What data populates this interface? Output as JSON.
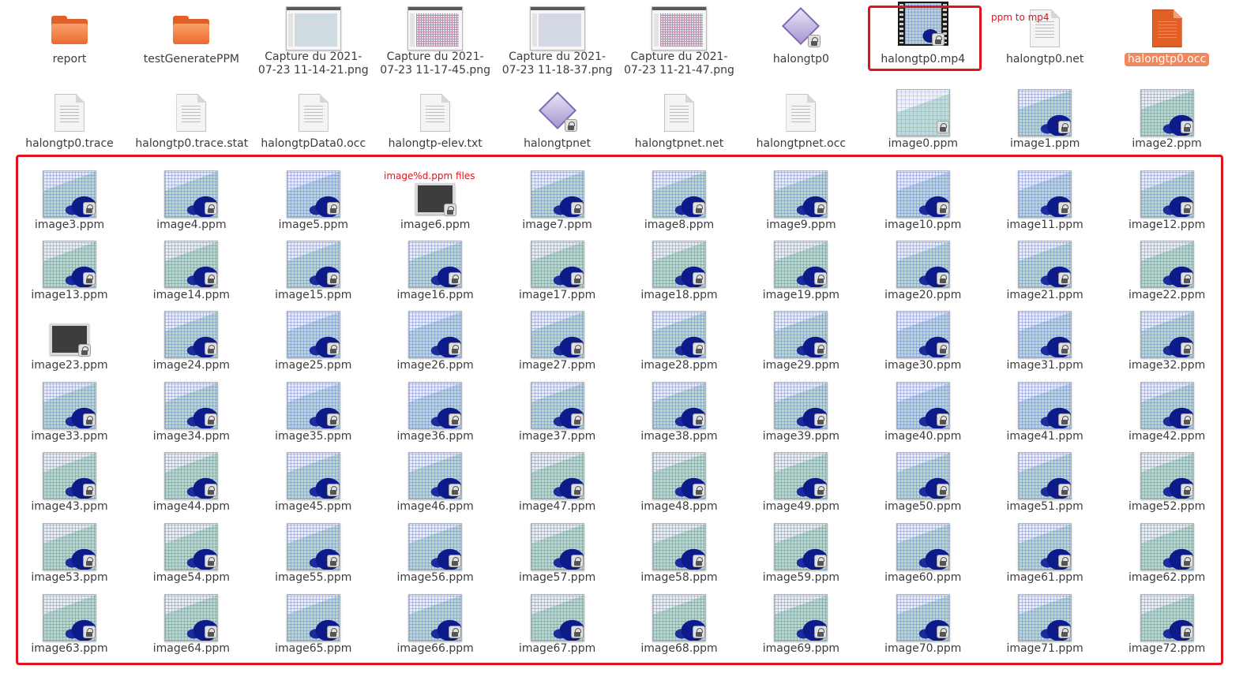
{
  "colors": {
    "annotation": "#e0141f",
    "selection": "#f0875e",
    "folder": "#e35f28"
  },
  "annotations": {
    "mp4_note": "ppm to mp4",
    "ppm_note": "image%d.ppm files"
  },
  "files": [
    {
      "name": "report",
      "kind": "folder"
    },
    {
      "name": "testGeneratePPM",
      "kind": "folder"
    },
    {
      "name": "Capture du 2021-07-23 11-14-21.png",
      "kind": "screenshot"
    },
    {
      "name": "Capture du 2021-07-23 11-17-45.png",
      "kind": "screenshot-grid"
    },
    {
      "name": "Capture du 2021-07-23 11-18-37.png",
      "kind": "screenshot"
    },
    {
      "name": "Capture du 2021-07-23 11-21-47.png",
      "kind": "screenshot-grid"
    },
    {
      "name": "halongtp0",
      "kind": "binary"
    },
    {
      "name": "halongtp0.mp4",
      "kind": "video"
    },
    {
      "name": "halongtp0.net",
      "kind": "text"
    },
    {
      "name": "halongtp0.occ",
      "kind": "text-orange",
      "selected": true
    },
    {
      "name": "halongtp0.trace",
      "kind": "text"
    },
    {
      "name": "halongtp0.trace.stat",
      "kind": "text"
    },
    {
      "name": "halongtpData0.occ",
      "kind": "text"
    },
    {
      "name": "halongtp-elev.txt",
      "kind": "text"
    },
    {
      "name": "halongtpnet",
      "kind": "binary"
    },
    {
      "name": "halongtpnet.net",
      "kind": "text"
    },
    {
      "name": "halongtpnet.occ",
      "kind": "text"
    },
    {
      "name": "image0.ppm",
      "kind": "ppm-plain"
    },
    {
      "name": "image1.ppm",
      "kind": "ppm"
    },
    {
      "name": "image2.ppm",
      "kind": "ppm"
    },
    {
      "name": "image3.ppm",
      "kind": "ppm"
    },
    {
      "name": "image4.ppm",
      "kind": "ppm"
    },
    {
      "name": "image5.ppm",
      "kind": "ppm"
    },
    {
      "name": "image6.ppm",
      "kind": "ppm-dark"
    },
    {
      "name": "image7.ppm",
      "kind": "ppm"
    },
    {
      "name": "image8.ppm",
      "kind": "ppm"
    },
    {
      "name": "image9.ppm",
      "kind": "ppm"
    },
    {
      "name": "image10.ppm",
      "kind": "ppm"
    },
    {
      "name": "image11.ppm",
      "kind": "ppm"
    },
    {
      "name": "image12.ppm",
      "kind": "ppm"
    },
    {
      "name": "image13.ppm",
      "kind": "ppm"
    },
    {
      "name": "image14.ppm",
      "kind": "ppm"
    },
    {
      "name": "image15.ppm",
      "kind": "ppm"
    },
    {
      "name": "image16.ppm",
      "kind": "ppm"
    },
    {
      "name": "image17.ppm",
      "kind": "ppm"
    },
    {
      "name": "image18.ppm",
      "kind": "ppm"
    },
    {
      "name": "image19.ppm",
      "kind": "ppm"
    },
    {
      "name": "image20.ppm",
      "kind": "ppm"
    },
    {
      "name": "image21.ppm",
      "kind": "ppm"
    },
    {
      "name": "image22.ppm",
      "kind": "ppm"
    },
    {
      "name": "image23.ppm",
      "kind": "ppm-dark"
    },
    {
      "name": "image24.ppm",
      "kind": "ppm"
    },
    {
      "name": "image25.ppm",
      "kind": "ppm"
    },
    {
      "name": "image26.ppm",
      "kind": "ppm"
    },
    {
      "name": "image27.ppm",
      "kind": "ppm"
    },
    {
      "name": "image28.ppm",
      "kind": "ppm"
    },
    {
      "name": "image29.ppm",
      "kind": "ppm"
    },
    {
      "name": "image30.ppm",
      "kind": "ppm"
    },
    {
      "name": "image31.ppm",
      "kind": "ppm"
    },
    {
      "name": "image32.ppm",
      "kind": "ppm"
    },
    {
      "name": "image33.ppm",
      "kind": "ppm"
    },
    {
      "name": "image34.ppm",
      "kind": "ppm"
    },
    {
      "name": "image35.ppm",
      "kind": "ppm"
    },
    {
      "name": "image36.ppm",
      "kind": "ppm"
    },
    {
      "name": "image37.ppm",
      "kind": "ppm"
    },
    {
      "name": "image38.ppm",
      "kind": "ppm"
    },
    {
      "name": "image39.ppm",
      "kind": "ppm"
    },
    {
      "name": "image40.ppm",
      "kind": "ppm"
    },
    {
      "name": "image41.ppm",
      "kind": "ppm"
    },
    {
      "name": "image42.ppm",
      "kind": "ppm"
    },
    {
      "name": "image43.ppm",
      "kind": "ppm"
    },
    {
      "name": "image44.ppm",
      "kind": "ppm"
    },
    {
      "name": "image45.ppm",
      "kind": "ppm"
    },
    {
      "name": "image46.ppm",
      "kind": "ppm"
    },
    {
      "name": "image47.ppm",
      "kind": "ppm"
    },
    {
      "name": "image48.ppm",
      "kind": "ppm"
    },
    {
      "name": "image49.ppm",
      "kind": "ppm"
    },
    {
      "name": "image50.ppm",
      "kind": "ppm"
    },
    {
      "name": "image51.ppm",
      "kind": "ppm"
    },
    {
      "name": "image52.ppm",
      "kind": "ppm"
    },
    {
      "name": "image53.ppm",
      "kind": "ppm"
    },
    {
      "name": "image54.ppm",
      "kind": "ppm"
    },
    {
      "name": "image55.ppm",
      "kind": "ppm"
    },
    {
      "name": "image56.ppm",
      "kind": "ppm"
    },
    {
      "name": "image57.ppm",
      "kind": "ppm"
    },
    {
      "name": "image58.ppm",
      "kind": "ppm"
    },
    {
      "name": "image59.ppm",
      "kind": "ppm"
    },
    {
      "name": "image60.ppm",
      "kind": "ppm"
    },
    {
      "name": "image61.ppm",
      "kind": "ppm"
    },
    {
      "name": "image62.ppm",
      "kind": "ppm"
    },
    {
      "name": "image63.ppm",
      "kind": "ppm"
    },
    {
      "name": "image64.ppm",
      "kind": "ppm"
    },
    {
      "name": "image65.ppm",
      "kind": "ppm"
    },
    {
      "name": "image66.ppm",
      "kind": "ppm"
    },
    {
      "name": "image67.ppm",
      "kind": "ppm"
    },
    {
      "name": "image68.ppm",
      "kind": "ppm"
    },
    {
      "name": "image69.ppm",
      "kind": "ppm"
    },
    {
      "name": "image70.ppm",
      "kind": "ppm"
    },
    {
      "name": "image71.ppm",
      "kind": "ppm"
    },
    {
      "name": "image72.ppm",
      "kind": "ppm"
    }
  ]
}
